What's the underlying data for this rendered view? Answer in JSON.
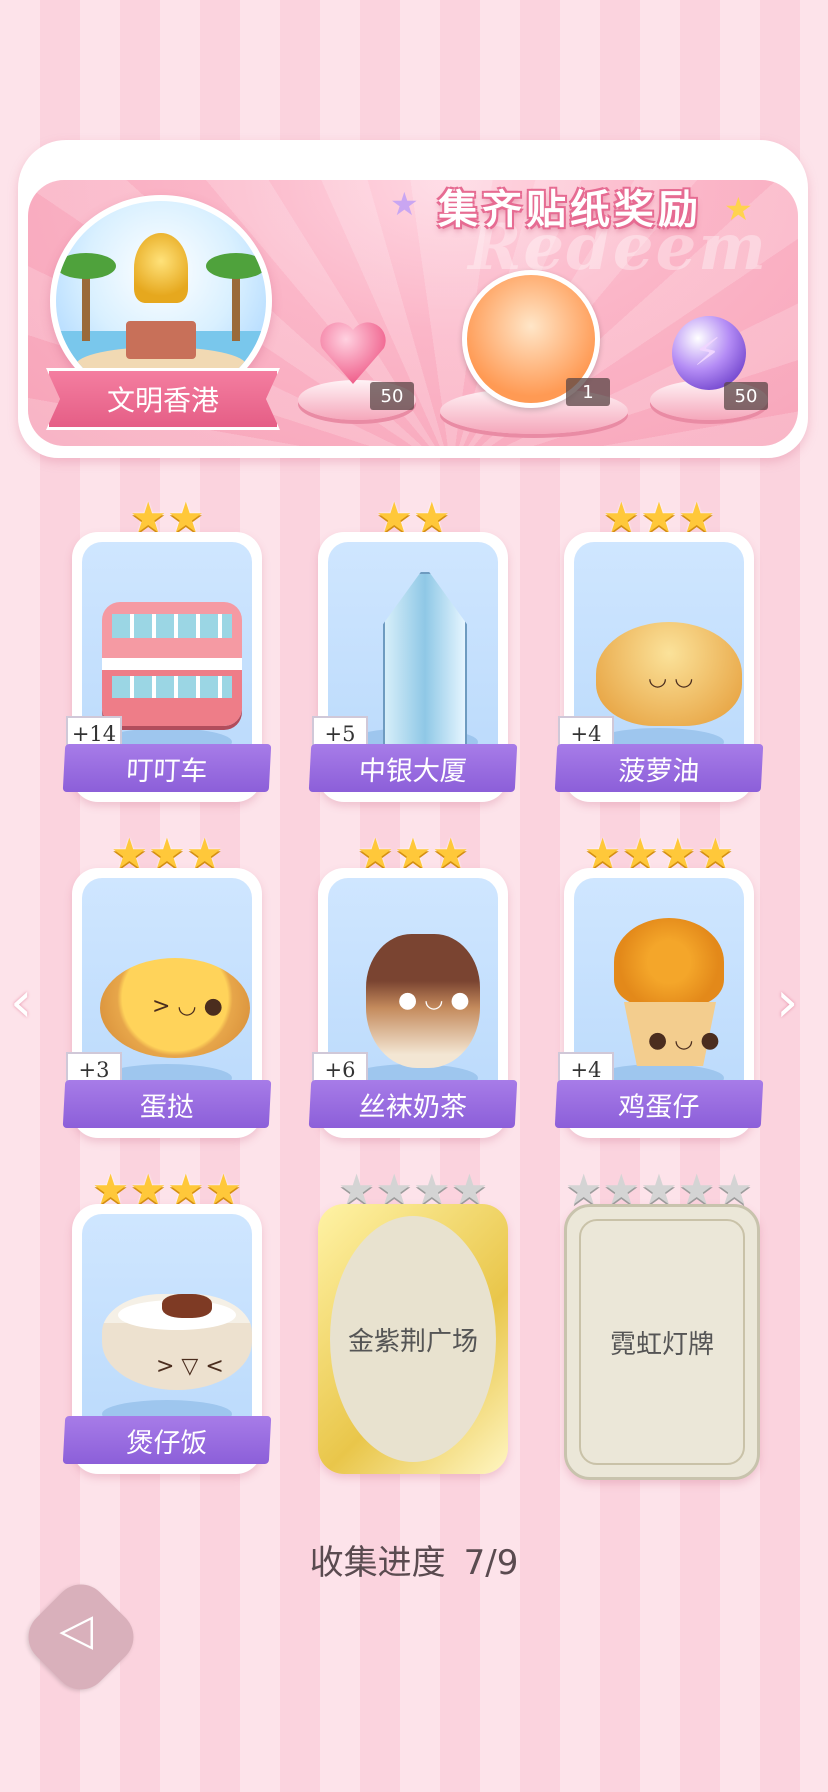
{
  "banner": {
    "title": "集齐贴纸奖励",
    "watermark": "Redeem",
    "city_label": "文明香港",
    "rewards": [
      {
        "name": "heart-gem",
        "count": "50"
      },
      {
        "name": "character-avatar",
        "count": "1"
      },
      {
        "name": "energy-orb",
        "count": "50"
      }
    ]
  },
  "cards": [
    {
      "label": "叮叮车",
      "bonus": "+14",
      "stars": 2,
      "locked": false
    },
    {
      "label": "中银大厦",
      "bonus": "+5",
      "stars": 2,
      "locked": false
    },
    {
      "label": "菠萝油",
      "bonus": "+4",
      "stars": 3,
      "locked": false
    },
    {
      "label": "蛋挞",
      "bonus": "+3",
      "stars": 3,
      "locked": false
    },
    {
      "label": "丝袜奶茶",
      "bonus": "+6",
      "stars": 3,
      "locked": false
    },
    {
      "label": "鸡蛋仔",
      "bonus": "+4",
      "stars": 4,
      "locked": false
    },
    {
      "label": "煲仔饭",
      "bonus": "",
      "stars": 4,
      "locked": false
    },
    {
      "label": "金紫荆广场",
      "bonus": "",
      "stars": 4,
      "locked": true
    },
    {
      "label": "霓虹灯牌",
      "bonus": "",
      "stars": 5,
      "locked": true
    }
  ],
  "progress": {
    "label": "收集进度",
    "value": "7/9"
  },
  "nav": {
    "prev": "‹",
    "next": "›",
    "back": "◁"
  }
}
